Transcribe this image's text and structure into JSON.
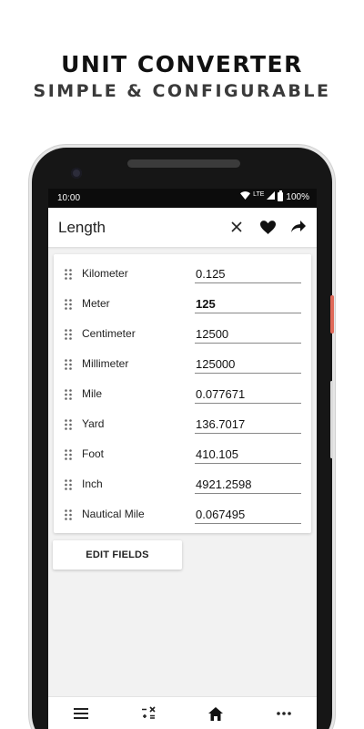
{
  "promo": {
    "title": "UNIT CONVERTER",
    "subtitle": "SIMPLE & CONFIGURABLE"
  },
  "status_bar": {
    "time": "10:00",
    "network": "LTE",
    "battery": "100%"
  },
  "app_bar": {
    "title": "Length",
    "actions": [
      "close-icon",
      "favorite-heart-icon",
      "share-icon"
    ]
  },
  "units": [
    {
      "name": "Kilometer",
      "value": "0.125",
      "active": false
    },
    {
      "name": "Meter",
      "value": "125",
      "active": true
    },
    {
      "name": "Centimeter",
      "value": "12500",
      "active": false
    },
    {
      "name": "Millimeter",
      "value": "125000",
      "active": false
    },
    {
      "name": "Mile",
      "value": "0.077671",
      "active": false
    },
    {
      "name": "Yard",
      "value": "136.7017",
      "active": false
    },
    {
      "name": "Foot",
      "value": "410.105",
      "active": false
    },
    {
      "name": "Inch",
      "value": "4921.2598",
      "active": false
    },
    {
      "name": "Nautical Mile",
      "value": "0.067495",
      "active": false
    }
  ],
  "edit_fields_label": "EDIT FIELDS",
  "bottom_nav": [
    "menu-icon",
    "calculator-icon",
    "home-icon",
    "more-icon"
  ],
  "colors": {
    "phone_frame": "#161616",
    "screen_bg": "#f2f2f2",
    "side_button_accent": "#e06a5a"
  }
}
